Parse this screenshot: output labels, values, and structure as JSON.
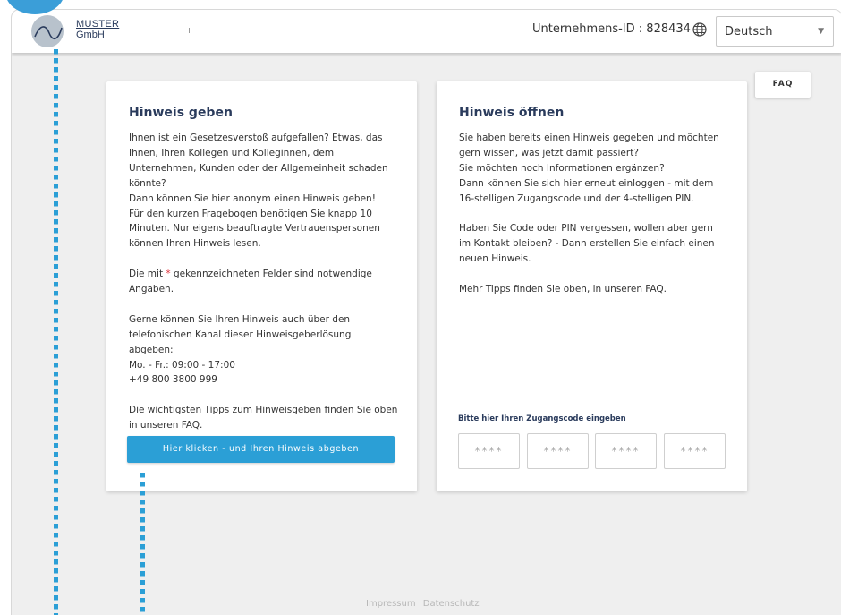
{
  "header": {
    "logo_line1": "MUSTER",
    "logo_line2": "GmbH",
    "company_id": "Unternehmens-ID : 828434",
    "language_value": "Deutsch"
  },
  "faq_button": "FAQ",
  "left_card": {
    "title": "Hinweis geben",
    "p1_lines": [
      "Ihnen ist ein Gesetzesverstoß aufgefallen? Etwas, das",
      "Ihnen, Ihren Kollegen und Kolleginnen, dem",
      "Unternehmen, Kunden oder der Allgemeinheit schaden",
      "könnte?",
      "Dann können Sie hier anonym einen Hinweis geben!",
      "Für den kurzen Fragebogen benötigen Sie knapp 10",
      "Minuten. Nur eigens beauftragte Vertrauenspersonen",
      "können Ihren Hinweis lesen."
    ],
    "p2_prefix": "Die mit ",
    "p2_star": "*",
    "p2_suffix": " gekennzeichneten Felder sind notwendige",
    "p2_line2": "Angaben.",
    "p3_lines": [
      "Gerne können Sie Ihren Hinweis auch über den",
      "telefonischen Kanal dieser Hinweisgeberlösung",
      "abgeben:",
      "Mo. - Fr.: 09:00 - 17:00",
      "+49 800 3800 999"
    ],
    "p4_lines": [
      "Die wichtigsten Tipps zum Hinweisgeben finden Sie oben",
      "in unseren FAQ."
    ],
    "cta_label": "Hier klicken -  und Ihren Hinweis abgeben"
  },
  "right_card": {
    "title": "Hinweis öffnen",
    "p1_lines": [
      "Sie haben bereits einen Hinweis gegeben und möchten",
      "gern wissen, was jetzt damit passiert?",
      "Sie möchten noch Informationen ergänzen?",
      "Dann können Sie sich hier erneut einloggen - mit dem",
      "16-stelligen Zugangscode und der 4-stelligen PIN."
    ],
    "p2_lines": [
      "Haben Sie Code oder PIN vergessen, wollen aber gern",
      "im Kontakt bleiben? - Dann erstellen Sie einfach einen",
      "neuen Hinweis."
    ],
    "p3_lines": [
      "Mehr Tipps finden Sie oben, in unseren FAQ."
    ],
    "code_label": "Bitte hier Ihren Zugangscode eingeben",
    "code_placeholders": [
      "****",
      "****",
      "****",
      "****"
    ]
  },
  "footer": {
    "impressum": "Impressum",
    "datenschutz": "Datenschutz"
  },
  "colors": {
    "accent": "#2b9fd6",
    "title": "#2a3b5c",
    "required": "#e0303a"
  }
}
